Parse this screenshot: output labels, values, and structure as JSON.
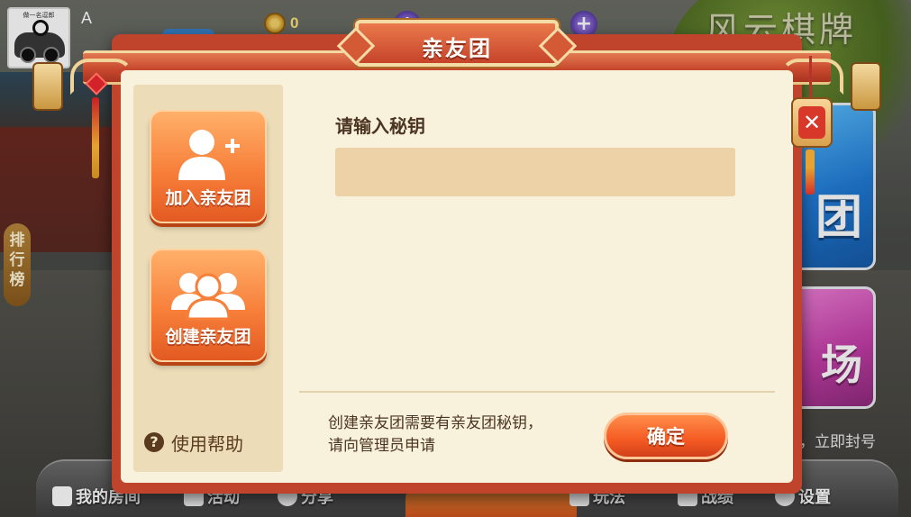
{
  "background": {
    "avatar_caption": "做一名逗郎",
    "player_name": "A",
    "coin_value": "0",
    "brand": "风云棋牌",
    "rank_tab": [
      "排",
      "行",
      "榜"
    ],
    "card_blue_text": "团",
    "card_pink_text": "场",
    "ban_text": "，立即封号",
    "bottom_nav": {
      "my_room": "我的房间",
      "activity": "活动",
      "share": "分享",
      "rules": "玩法",
      "record": "战绩",
      "settings": "设置"
    }
  },
  "modal": {
    "title": "亲友团",
    "sidebar": {
      "join_label": "加入亲友团",
      "create_label": "创建亲友团",
      "help_label": "使用帮助",
      "help_icon_glyph": "?"
    },
    "key_label": "请输入秘钥",
    "key_input": {
      "value": "",
      "placeholder": ""
    },
    "footnote_line1": "创建亲友团需要有亲友团秘钥，",
    "footnote_line2": "请向管理员申请",
    "confirm_label": "确定",
    "close_glyph": "✕"
  },
  "colors": {
    "modal_frame": "#c0432c",
    "panel_bg": "#f8f1dc",
    "sidebar_bg": "#ecdcb7",
    "input_bg": "#ecd2a6",
    "button_orange": "#f45a22",
    "text_brown": "#4b3522"
  }
}
